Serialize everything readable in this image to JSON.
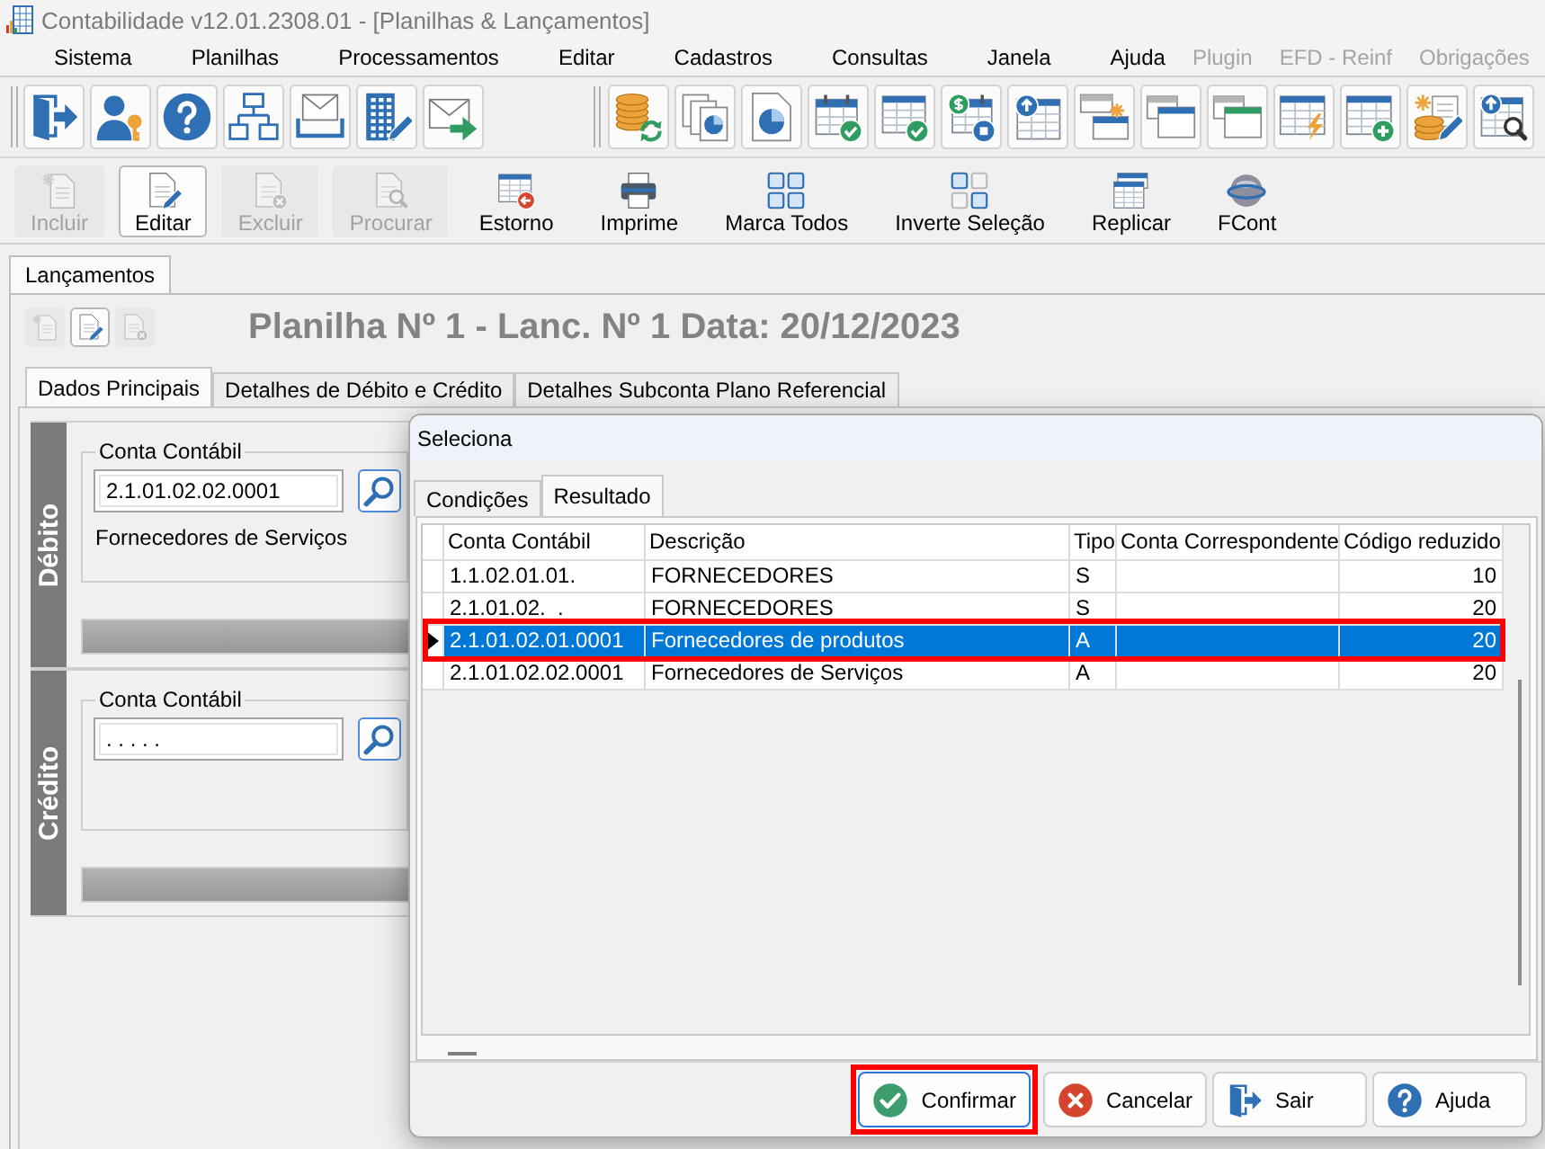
{
  "window": {
    "title": "Contabilidade v12.01.2308.01 - [Planilhas & Lançamentos]"
  },
  "menu": [
    {
      "label": "Sistema",
      "disabled": false
    },
    {
      "label": "Planilhas",
      "disabled": false
    },
    {
      "label": "Processamentos",
      "disabled": false
    },
    {
      "label": "Editar",
      "disabled": false
    },
    {
      "label": "Cadastros",
      "disabled": false
    },
    {
      "label": "Consultas",
      "disabled": false
    },
    {
      "label": "Janela",
      "disabled": false
    },
    {
      "label": "Ajuda",
      "disabled": false
    },
    {
      "label": "Plugin",
      "disabled": true
    },
    {
      "label": "EFD - Reinf",
      "disabled": true
    },
    {
      "label": "Obrigações",
      "disabled": true
    }
  ],
  "actions": [
    {
      "label": "Incluir",
      "disabled": true,
      "focused": false
    },
    {
      "label": "Editar",
      "disabled": false,
      "focused": true
    },
    {
      "label": "Excluir",
      "disabled": true,
      "focused": false
    },
    {
      "label": "Procurar",
      "disabled": true,
      "focused": false
    },
    {
      "label": "Estorno",
      "disabled": false,
      "focused": false
    },
    {
      "label": "Imprime",
      "disabled": false,
      "focused": false
    },
    {
      "label": "Marca Todos",
      "disabled": false,
      "focused": false
    },
    {
      "label": "Inverte Seleção",
      "disabled": false,
      "focused": false
    },
    {
      "label": "Replicar",
      "disabled": false,
      "focused": false
    },
    {
      "label": "FCont",
      "disabled": false,
      "focused": false
    }
  ],
  "document_tabs": [
    {
      "label": "Lançamentos",
      "selected": true
    }
  ],
  "record_toolbar": [
    {
      "disabled": true,
      "focused": false
    },
    {
      "disabled": false,
      "focused": true
    },
    {
      "disabled": true,
      "focused": false
    }
  ],
  "heading": "Planilha Nº 1 - Lanc. Nº 1 Data: 20/12/2023",
  "form_tabs": [
    {
      "label": "Dados Principais",
      "selected": true
    },
    {
      "label": "Detalhes de Débito e Crédito",
      "selected": false
    },
    {
      "label": "Detalhes Subconta Plano Referencial",
      "selected": false
    }
  ],
  "sections": [
    {
      "title": "Débito",
      "field_label": "Conta Contábil",
      "value": "2.1.01.02.02.0001",
      "description": "Fornecedores de Serviços"
    },
    {
      "title": "Crédito",
      "field_label": "Conta Contábil",
      "value": ". . . . ."
    }
  ],
  "dialog": {
    "title": "Seleciona",
    "tabs": [
      {
        "label": "Condições",
        "selected": false
      },
      {
        "label": "Resultado",
        "selected": true
      }
    ],
    "table": {
      "columns": [
        "Conta Contábil",
        "Descrição",
        "Tipo",
        "Conta Correspondente",
        "Código reduzido"
      ],
      "rows": [
        {
          "conta_contabil": "1.1.02.01.01.",
          "descricao": "FORNECEDORES",
          "tipo": "S",
          "codigo_reduzido": "10",
          "selected": false,
          "outlined": false
        },
        {
          "conta_contabil": "2.1.01.02.  .",
          "descricao": "FORNECEDORES",
          "tipo": "S",
          "codigo_reduzido": "20",
          "selected": false,
          "outlined": false
        },
        {
          "conta_contabil": "2.1.01.02.01.0001",
          "descricao": "Fornecedores de produtos",
          "tipo": "A",
          "codigo_reduzido": "20",
          "selected": true,
          "outlined": true
        },
        {
          "conta_contabil": "2.1.01.02.02.0001",
          "descricao": "Fornecedores de Serviços",
          "tipo": "A",
          "codigo_reduzido": "20",
          "selected": false,
          "outlined": false
        }
      ]
    },
    "buttons": [
      {
        "label": "Confirmar",
        "default": true,
        "outlined": true
      },
      {
        "label": "Cancelar",
        "default": false,
        "outlined": false
      },
      {
        "label": "Sair",
        "default": false,
        "outlined": false
      },
      {
        "label": "Ajuda",
        "default": false,
        "outlined": false
      }
    ]
  }
}
